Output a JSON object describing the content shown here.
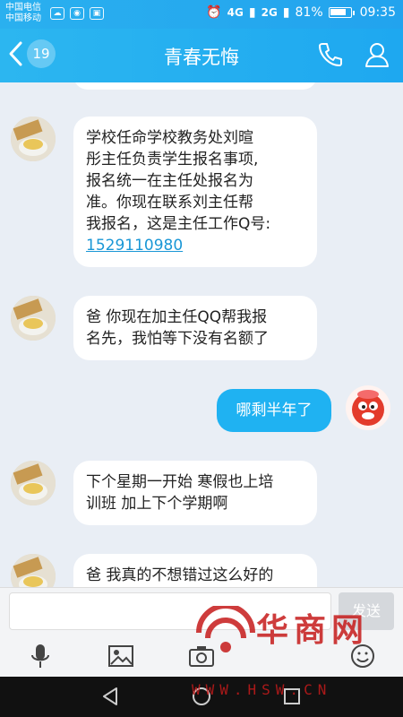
{
  "status": {
    "carrier1": "中国电信",
    "carrier2": "中国移动",
    "network1": "4G",
    "network2": "2G",
    "battery_level_percent": 81,
    "battery_text": "81%",
    "time": "09:35"
  },
  "header": {
    "unread_count": "19",
    "title": "青春无悔"
  },
  "messages": [
    {
      "side": "left",
      "lines": [
        "学校任命学校教务处刘暄",
        "彤主任负责学生报名事项,",
        "报名统一在主任处报名为",
        "准。你现在联系刘主任帮",
        "我报名，这是主任工作Q号:"
      ],
      "link": "1529110980"
    },
    {
      "side": "left",
      "lines": [
        "爸 你现在加主任QQ帮我报",
        "名先，我怕等下没有名额了"
      ]
    },
    {
      "side": "right",
      "lines": [
        "哪剩半年了"
      ]
    },
    {
      "side": "left",
      "lines": [
        "下个星期一开始 寒假也上培",
        "训班 加上下个学期啊"
      ]
    },
    {
      "side": "left",
      "lines": [
        "爸 我真的不想错过这么好的"
      ]
    }
  ],
  "input": {
    "value": "",
    "send_label": "发送"
  },
  "watermark": {
    "title": "华商网",
    "url": "WWW.HSW.CN"
  },
  "colors": {
    "header": "#22a9ef",
    "outgoing_bubble": "#1fb2f2",
    "incoming_bubble": "#ffffff",
    "link": "#1a97d6",
    "watermark": "#c61b1b"
  }
}
